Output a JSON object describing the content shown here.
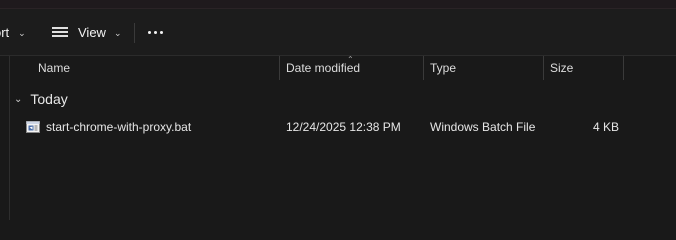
{
  "toolbar": {
    "sort_label": "ort",
    "view_label": "View",
    "more_icon": "more-icon"
  },
  "columns": {
    "name": "Name",
    "date_modified": "Date modified",
    "type": "Type",
    "size": "Size"
  },
  "group": {
    "label": "Today"
  },
  "files": [
    {
      "name": "start-chrome-with-proxy.bat",
      "date_modified": "12/24/2025 12:38 PM",
      "type": "Windows Batch File",
      "size": "4 KB",
      "icon": "batch-file-icon"
    }
  ],
  "colors": {
    "background": "#191919",
    "toolbar": "#1c1c1c",
    "text": "#e6e6e6"
  }
}
